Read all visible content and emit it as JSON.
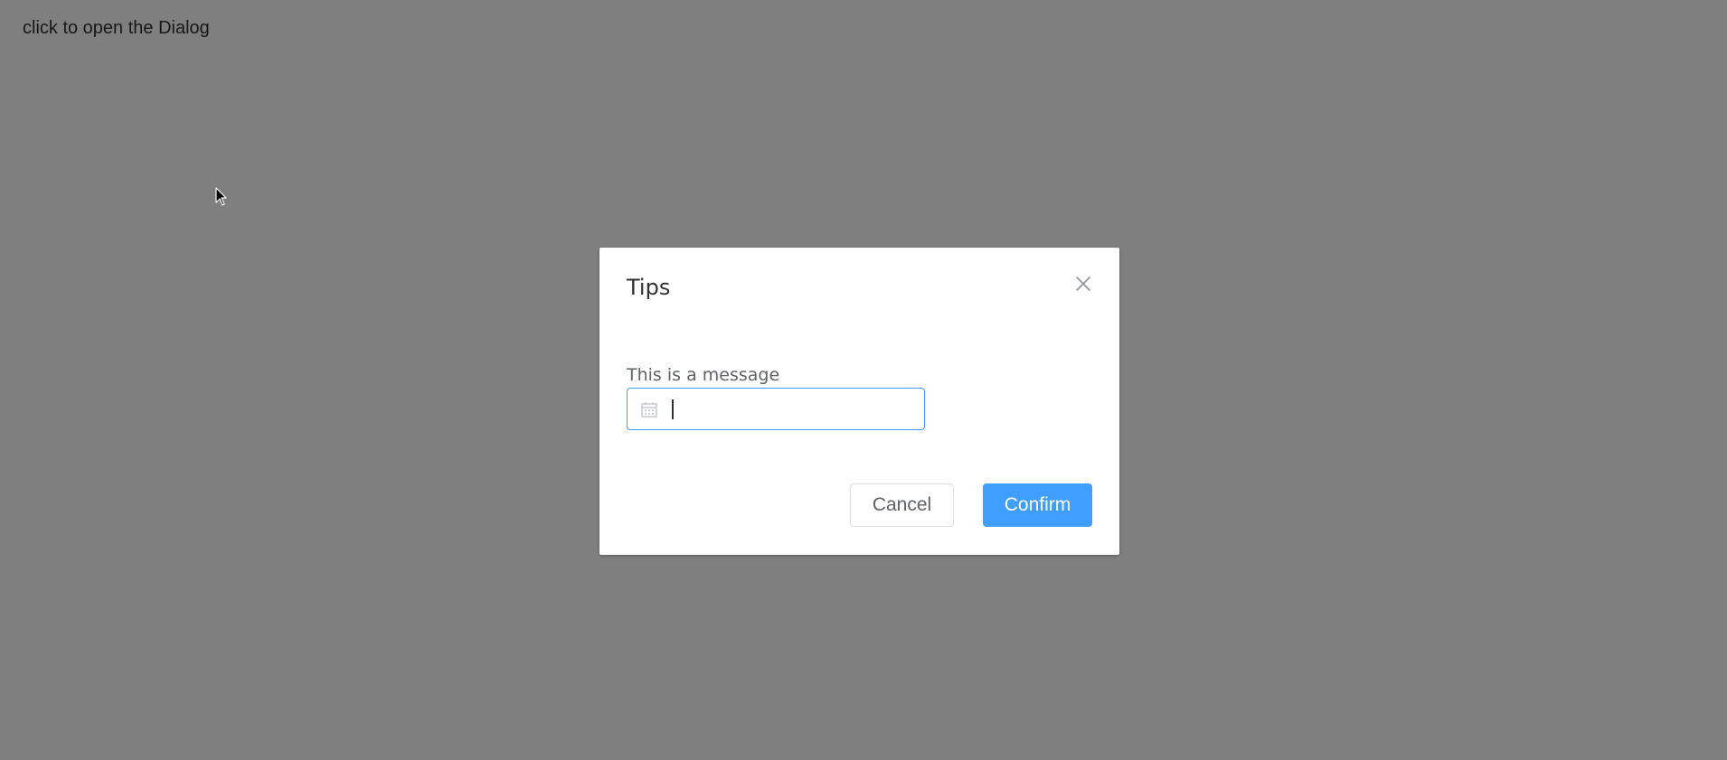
{
  "page": {
    "trigger_text": "click to open the Dialog"
  },
  "dialog": {
    "title": "Tips",
    "message": "This is a message",
    "date_input": {
      "value": "",
      "placeholder": ""
    },
    "buttons": {
      "cancel": "Cancel",
      "confirm": "Confirm"
    }
  },
  "icons": {
    "close": "close-icon",
    "calendar": "calendar-icon",
    "cursor": "mouse-pointer-icon"
  },
  "colors": {
    "overlay": "#808080",
    "primary": "#409eff",
    "text_primary": "#303133",
    "text_regular": "#606266",
    "border": "#dcdfe6"
  }
}
